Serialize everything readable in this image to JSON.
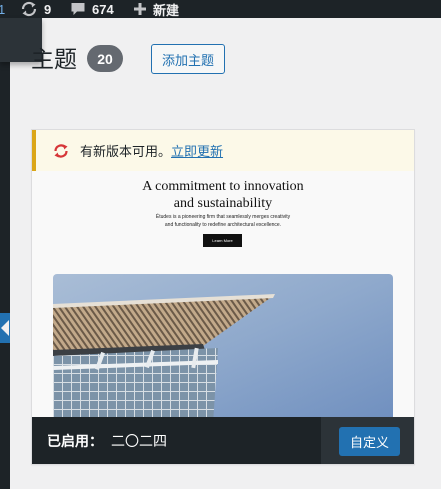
{
  "admin_bar": {
    "site_fragment": "1",
    "updates_count": "9",
    "comments_count": "674",
    "new_label": "新建"
  },
  "heading": {
    "title": "主题",
    "count": "20",
    "add_button": "添加主题"
  },
  "active_theme": {
    "update_notice_text": "有新版本可用。",
    "update_link": "立即更新",
    "screenshot": {
      "title_line1": "A commitment to innovation",
      "title_line2": "and sustainability",
      "subtitle_line1": "Études is a pioneering firm that seamlessly merges creativity",
      "subtitle_line2": "and functionality to redefine architectural excellence.",
      "button_label": "Learn More"
    },
    "active_label": "已启用：",
    "name": "二〇二四",
    "customize_button": "自定义"
  },
  "colors": {
    "admin_bar_bg": "#1d2327",
    "accent_blue": "#2271b1",
    "notice_border": "#dba617",
    "update_icon_red": "#d63638"
  },
  "icons": {
    "updates": "refresh-icon",
    "comments": "speech-bubble-icon",
    "new": "plus-icon",
    "notice": "update-refresh-icon"
  }
}
